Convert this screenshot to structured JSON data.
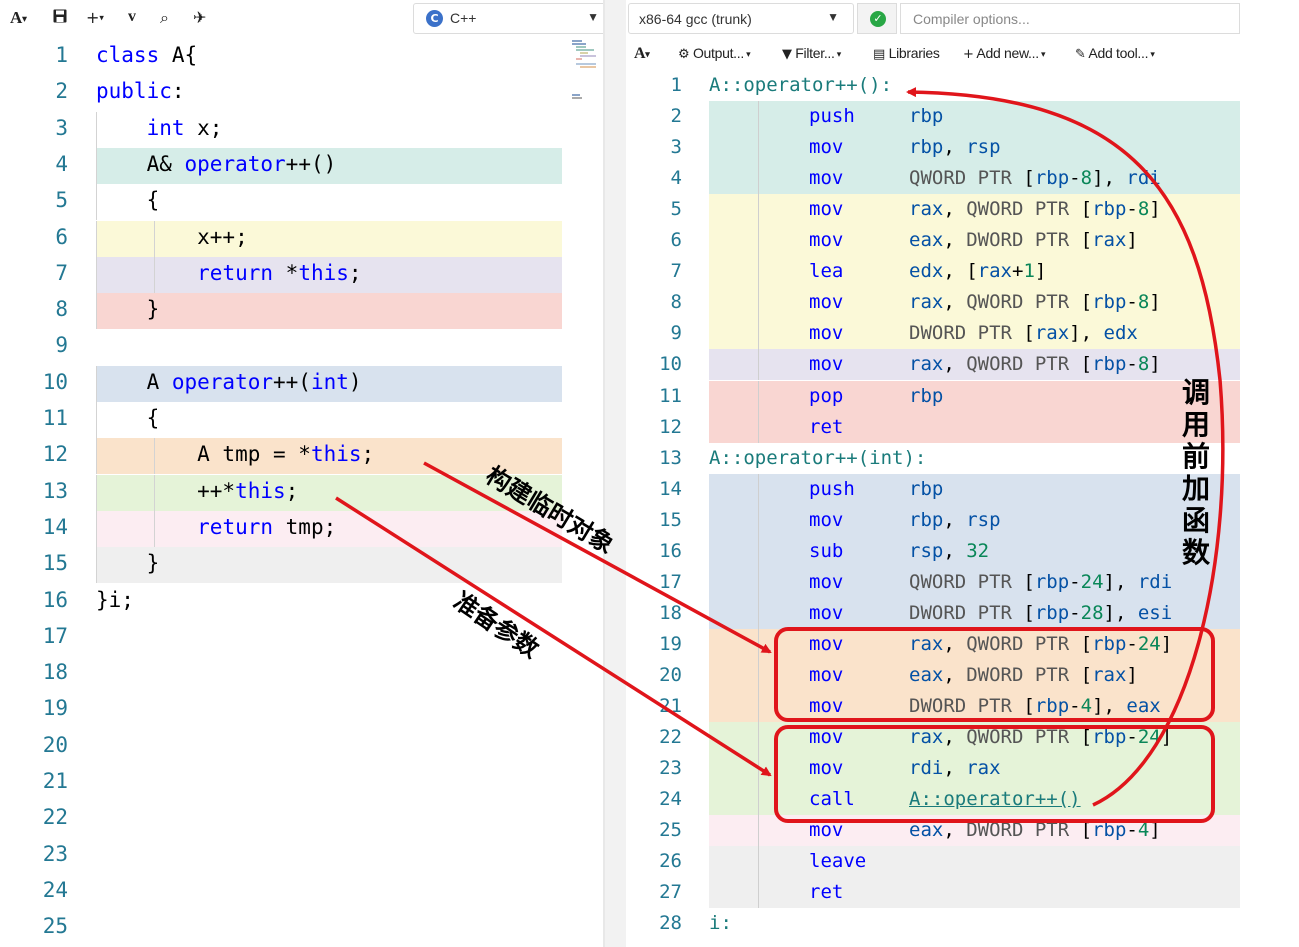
{
  "left_toolbar": {
    "font_btn": "A",
    "save_icon": "save-icon",
    "add_btn": "+",
    "vim_btn": "v",
    "lang": "C++"
  },
  "source": {
    "lines": [
      {
        "n": "1",
        "hl": "",
        "indent": 0,
        "tokens": [
          {
            "t": "class",
            "c": "kw"
          },
          {
            "t": " A{",
            "c": ""
          }
        ]
      },
      {
        "n": "2",
        "hl": "",
        "indent": 0,
        "tokens": [
          {
            "t": "public",
            "c": "kw"
          },
          {
            "t": ":",
            "c": ""
          }
        ]
      },
      {
        "n": "3",
        "hl": "",
        "indent": 1,
        "tokens": [
          {
            "t": "    ",
            "c": ""
          },
          {
            "t": "int",
            "c": "kw"
          },
          {
            "t": " x;",
            "c": ""
          }
        ]
      },
      {
        "n": "4",
        "hl": "#d6ede8",
        "indent": 1,
        "tokens": [
          {
            "t": "    A& ",
            "c": ""
          },
          {
            "t": "operator",
            "c": "kw"
          },
          {
            "t": "++()",
            "c": ""
          }
        ]
      },
      {
        "n": "5",
        "hl": "",
        "indent": 1,
        "tokens": [
          {
            "t": "    {",
            "c": ""
          }
        ]
      },
      {
        "n": "6",
        "hl": "#fbf9d8",
        "indent": 2,
        "tokens": [
          {
            "t": "        x++;",
            "c": ""
          }
        ]
      },
      {
        "n": "7",
        "hl": "#e6e3ef",
        "indent": 2,
        "tokens": [
          {
            "t": "        ",
            "c": ""
          },
          {
            "t": "return",
            "c": "kw"
          },
          {
            "t": " *",
            "c": ""
          },
          {
            "t": "this",
            "c": "kw"
          },
          {
            "t": ";",
            "c": ""
          }
        ]
      },
      {
        "n": "8",
        "hl": "#f9d6d2",
        "indent": 1,
        "tokens": [
          {
            "t": "    }",
            "c": ""
          }
        ]
      },
      {
        "n": "9",
        "hl": "",
        "indent": 0,
        "tokens": []
      },
      {
        "n": "10",
        "hl": "#d8e2ee",
        "indent": 1,
        "tokens": [
          {
            "t": "    A ",
            "c": ""
          },
          {
            "t": "operator",
            "c": "kw"
          },
          {
            "t": "++(",
            "c": ""
          },
          {
            "t": "int",
            "c": "kw"
          },
          {
            "t": ")",
            "c": ""
          }
        ]
      },
      {
        "n": "11",
        "hl": "",
        "indent": 1,
        "tokens": [
          {
            "t": "    {",
            "c": ""
          }
        ]
      },
      {
        "n": "12",
        "hl": "#fae3cb",
        "indent": 2,
        "tokens": [
          {
            "t": "        A tmp = *",
            "c": ""
          },
          {
            "t": "this",
            "c": "kw"
          },
          {
            "t": ";",
            "c": ""
          }
        ]
      },
      {
        "n": "13",
        "hl": "#e5f3d8",
        "indent": 2,
        "tokens": [
          {
            "t": "        ++*",
            "c": ""
          },
          {
            "t": "this",
            "c": "kw"
          },
          {
            "t": ";",
            "c": ""
          }
        ]
      },
      {
        "n": "14",
        "hl": "#fcedf2",
        "indent": 2,
        "tokens": [
          {
            "t": "        ",
            "c": ""
          },
          {
            "t": "return",
            "c": "kw"
          },
          {
            "t": " tmp;",
            "c": ""
          }
        ]
      },
      {
        "n": "15",
        "hl": "#efefef",
        "indent": 1,
        "tokens": [
          {
            "t": "    }",
            "c": ""
          }
        ]
      },
      {
        "n": "16",
        "hl": "",
        "indent": 0,
        "tokens": [
          {
            "t": "}i;",
            "c": ""
          }
        ]
      },
      {
        "n": "17",
        "hl": "",
        "indent": 0,
        "tokens": []
      },
      {
        "n": "18",
        "hl": "",
        "indent": 0,
        "tokens": []
      },
      {
        "n": "19",
        "hl": "",
        "indent": 0,
        "tokens": []
      },
      {
        "n": "20",
        "hl": "",
        "indent": 0,
        "tokens": []
      },
      {
        "n": "21",
        "hl": "",
        "indent": 0,
        "tokens": []
      },
      {
        "n": "22",
        "hl": "",
        "indent": 0,
        "tokens": []
      },
      {
        "n": "23",
        "hl": "",
        "indent": 0,
        "tokens": []
      },
      {
        "n": "24",
        "hl": "",
        "indent": 0,
        "tokens": []
      },
      {
        "n": "25",
        "hl": "",
        "indent": 0,
        "tokens": []
      }
    ]
  },
  "compiler": {
    "name": "x86-64 gcc (trunk)",
    "options_placeholder": "Compiler options...",
    "toolbar": {
      "font_btn": "A",
      "output": "Output...",
      "filter": "Filter...",
      "libraries": "Libraries",
      "add_new": "Add new...",
      "add_tool": "Add tool..."
    }
  },
  "asm": {
    "lines": [
      {
        "n": "1",
        "hl": "",
        "label": "A::operator++():",
        "op": "",
        "args": []
      },
      {
        "n": "2",
        "hl": "#d6ede8",
        "label": "",
        "op": "push",
        "args": [
          {
            "t": "rbp",
            "c": "reg"
          }
        ]
      },
      {
        "n": "3",
        "hl": "#d6ede8",
        "label": "",
        "op": "mov",
        "args": [
          {
            "t": "rbp",
            "c": "reg"
          },
          {
            "t": ", ",
            "c": ""
          },
          {
            "t": "rsp",
            "c": "reg"
          }
        ]
      },
      {
        "n": "4",
        "hl": "#d6ede8",
        "label": "",
        "op": "mov",
        "args": [
          {
            "t": "QWORD PTR ",
            "c": "ptr"
          },
          {
            "t": "[",
            "c": ""
          },
          {
            "t": "rbp",
            "c": "reg"
          },
          {
            "t": "-",
            "c": ""
          },
          {
            "t": "8",
            "c": "num"
          },
          {
            "t": "], ",
            "c": ""
          },
          {
            "t": "rdi",
            "c": "reg"
          }
        ]
      },
      {
        "n": "5",
        "hl": "#fbf9d8",
        "label": "",
        "op": "mov",
        "args": [
          {
            "t": "rax",
            "c": "reg"
          },
          {
            "t": ", ",
            "c": ""
          },
          {
            "t": "QWORD PTR ",
            "c": "ptr"
          },
          {
            "t": "[",
            "c": ""
          },
          {
            "t": "rbp",
            "c": "reg"
          },
          {
            "t": "-",
            "c": ""
          },
          {
            "t": "8",
            "c": "num"
          },
          {
            "t": "]",
            "c": ""
          }
        ]
      },
      {
        "n": "6",
        "hl": "#fbf9d8",
        "label": "",
        "op": "mov",
        "args": [
          {
            "t": "eax",
            "c": "reg"
          },
          {
            "t": ", ",
            "c": ""
          },
          {
            "t": "DWORD PTR ",
            "c": "ptr"
          },
          {
            "t": "[",
            "c": ""
          },
          {
            "t": "rax",
            "c": "reg"
          },
          {
            "t": "]",
            "c": ""
          }
        ]
      },
      {
        "n": "7",
        "hl": "#fbf9d8",
        "label": "",
        "op": "lea",
        "args": [
          {
            "t": "edx",
            "c": "reg"
          },
          {
            "t": ", [",
            "c": ""
          },
          {
            "t": "rax",
            "c": "reg"
          },
          {
            "t": "+",
            "c": ""
          },
          {
            "t": "1",
            "c": "num"
          },
          {
            "t": "]",
            "c": ""
          }
        ]
      },
      {
        "n": "8",
        "hl": "#fbf9d8",
        "label": "",
        "op": "mov",
        "args": [
          {
            "t": "rax",
            "c": "reg"
          },
          {
            "t": ", ",
            "c": ""
          },
          {
            "t": "QWORD PTR ",
            "c": "ptr"
          },
          {
            "t": "[",
            "c": ""
          },
          {
            "t": "rbp",
            "c": "reg"
          },
          {
            "t": "-",
            "c": ""
          },
          {
            "t": "8",
            "c": "num"
          },
          {
            "t": "]",
            "c": ""
          }
        ]
      },
      {
        "n": "9",
        "hl": "#fbf9d8",
        "label": "",
        "op": "mov",
        "args": [
          {
            "t": "DWORD PTR ",
            "c": "ptr"
          },
          {
            "t": "[",
            "c": ""
          },
          {
            "t": "rax",
            "c": "reg"
          },
          {
            "t": "], ",
            "c": ""
          },
          {
            "t": "edx",
            "c": "reg"
          }
        ]
      },
      {
        "n": "10",
        "hl": "#e6e3ef",
        "label": "",
        "op": "mov",
        "args": [
          {
            "t": "rax",
            "c": "reg"
          },
          {
            "t": ", ",
            "c": ""
          },
          {
            "t": "QWORD PTR ",
            "c": "ptr"
          },
          {
            "t": "[",
            "c": ""
          },
          {
            "t": "rbp",
            "c": "reg"
          },
          {
            "t": "-",
            "c": ""
          },
          {
            "t": "8",
            "c": "num"
          },
          {
            "t": "]",
            "c": ""
          }
        ]
      },
      {
        "n": "11",
        "hl": "#f9d6d2",
        "label": "",
        "op": "pop",
        "args": [
          {
            "t": "rbp",
            "c": "reg"
          }
        ]
      },
      {
        "n": "12",
        "hl": "#f9d6d2",
        "label": "",
        "op": "ret",
        "args": []
      },
      {
        "n": "13",
        "hl": "",
        "label": "A::operator++(int):",
        "op": "",
        "args": []
      },
      {
        "n": "14",
        "hl": "#d8e2ee",
        "label": "",
        "op": "push",
        "args": [
          {
            "t": "rbp",
            "c": "reg"
          }
        ]
      },
      {
        "n": "15",
        "hl": "#d8e2ee",
        "label": "",
        "op": "mov",
        "args": [
          {
            "t": "rbp",
            "c": "reg"
          },
          {
            "t": ", ",
            "c": ""
          },
          {
            "t": "rsp",
            "c": "reg"
          }
        ]
      },
      {
        "n": "16",
        "hl": "#d8e2ee",
        "label": "",
        "op": "sub",
        "args": [
          {
            "t": "rsp",
            "c": "reg"
          },
          {
            "t": ", ",
            "c": ""
          },
          {
            "t": "32",
            "c": "num"
          }
        ]
      },
      {
        "n": "17",
        "hl": "#d8e2ee",
        "label": "",
        "op": "mov",
        "args": [
          {
            "t": "QWORD PTR ",
            "c": "ptr"
          },
          {
            "t": "[",
            "c": ""
          },
          {
            "t": "rbp",
            "c": "reg"
          },
          {
            "t": "-",
            "c": ""
          },
          {
            "t": "24",
            "c": "num"
          },
          {
            "t": "], ",
            "c": ""
          },
          {
            "t": "rdi",
            "c": "reg"
          }
        ]
      },
      {
        "n": "18",
        "hl": "#d8e2ee",
        "label": "",
        "op": "mov",
        "args": [
          {
            "t": "DWORD PTR ",
            "c": "ptr"
          },
          {
            "t": "[",
            "c": ""
          },
          {
            "t": "rbp",
            "c": "reg"
          },
          {
            "t": "-",
            "c": ""
          },
          {
            "t": "28",
            "c": "num"
          },
          {
            "t": "], ",
            "c": ""
          },
          {
            "t": "esi",
            "c": "reg"
          }
        ]
      },
      {
        "n": "19",
        "hl": "#fae3cb",
        "label": "",
        "op": "mov",
        "args": [
          {
            "t": "rax",
            "c": "reg"
          },
          {
            "t": ", ",
            "c": ""
          },
          {
            "t": "QWORD PTR ",
            "c": "ptr"
          },
          {
            "t": "[",
            "c": ""
          },
          {
            "t": "rbp",
            "c": "reg"
          },
          {
            "t": "-",
            "c": ""
          },
          {
            "t": "24",
            "c": "num"
          },
          {
            "t": "]",
            "c": ""
          }
        ]
      },
      {
        "n": "20",
        "hl": "#fae3cb",
        "label": "",
        "op": "mov",
        "args": [
          {
            "t": "eax",
            "c": "reg"
          },
          {
            "t": ", ",
            "c": ""
          },
          {
            "t": "DWORD PTR ",
            "c": "ptr"
          },
          {
            "t": "[",
            "c": ""
          },
          {
            "t": "rax",
            "c": "reg"
          },
          {
            "t": "]",
            "c": ""
          }
        ]
      },
      {
        "n": "21",
        "hl": "#fae3cb",
        "label": "",
        "op": "mov",
        "args": [
          {
            "t": "DWORD PTR ",
            "c": "ptr"
          },
          {
            "t": "[",
            "c": ""
          },
          {
            "t": "rbp",
            "c": "reg"
          },
          {
            "t": "-",
            "c": ""
          },
          {
            "t": "4",
            "c": "num"
          },
          {
            "t": "], ",
            "c": ""
          },
          {
            "t": "eax",
            "c": "reg"
          }
        ]
      },
      {
        "n": "22",
        "hl": "#e5f3d8",
        "label": "",
        "op": "mov",
        "args": [
          {
            "t": "rax",
            "c": "reg"
          },
          {
            "t": ", ",
            "c": ""
          },
          {
            "t": "QWORD PTR ",
            "c": "ptr"
          },
          {
            "t": "[",
            "c": ""
          },
          {
            "t": "rbp",
            "c": "reg"
          },
          {
            "t": "-",
            "c": ""
          },
          {
            "t": "24",
            "c": "num"
          },
          {
            "t": "]",
            "c": ""
          }
        ]
      },
      {
        "n": "23",
        "hl": "#e5f3d8",
        "label": "",
        "op": "mov",
        "args": [
          {
            "t": "rdi",
            "c": "reg"
          },
          {
            "t": ", ",
            "c": ""
          },
          {
            "t": "rax",
            "c": "reg"
          }
        ]
      },
      {
        "n": "24",
        "hl": "#e5f3d8",
        "label": "",
        "op": "call",
        "args": [
          {
            "t": "A::operator++()",
            "c": "link"
          }
        ]
      },
      {
        "n": "25",
        "hl": "#fcedf2",
        "label": "",
        "op": "mov",
        "args": [
          {
            "t": "eax",
            "c": "reg"
          },
          {
            "t": ", ",
            "c": ""
          },
          {
            "t": "DWORD PTR ",
            "c": "ptr"
          },
          {
            "t": "[",
            "c": ""
          },
          {
            "t": "rbp",
            "c": "reg"
          },
          {
            "t": "-",
            "c": ""
          },
          {
            "t": "4",
            "c": "num"
          },
          {
            "t": "]",
            "c": ""
          }
        ]
      },
      {
        "n": "26",
        "hl": "#efefef",
        "label": "",
        "op": "leave",
        "args": []
      },
      {
        "n": "27",
        "hl": "#efefef",
        "label": "",
        "op": "ret",
        "args": []
      },
      {
        "n": "28",
        "hl": "",
        "label": "i:",
        "op": "",
        "args": []
      }
    ]
  },
  "annotations": {
    "construct_temp": "构建临时对象",
    "prepare_args": "准备参数",
    "call_prefix": "调用前加函数",
    "color": "#e0151b"
  }
}
